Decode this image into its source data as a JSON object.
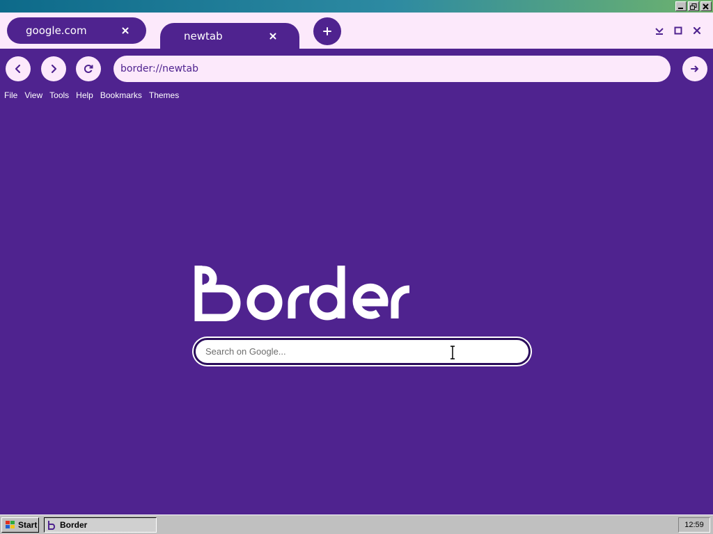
{
  "tabs": [
    {
      "label": "google.com"
    },
    {
      "label": "newtab"
    }
  ],
  "address_bar": {
    "value": "border://newtab"
  },
  "menu": [
    "File",
    "View",
    "Tools",
    "Help",
    "Bookmarks",
    "Themes"
  ],
  "logo_text": "Border",
  "search": {
    "placeholder": "Search on Google..."
  },
  "taskbar": {
    "start_label": "Start",
    "task_label": "Border",
    "clock": "12:59"
  },
  "colors": {
    "accent": "#4f238f",
    "tab_strip": "#fce9fb"
  },
  "icons": [
    "close-icon",
    "plus-icon",
    "minimize-icon",
    "maximize-icon",
    "chevron-left-icon",
    "chevron-right-icon",
    "refresh-icon",
    "arrow-right-icon",
    "windows-logo-icon",
    "border-app-icon",
    "text-cursor-icon"
  ]
}
